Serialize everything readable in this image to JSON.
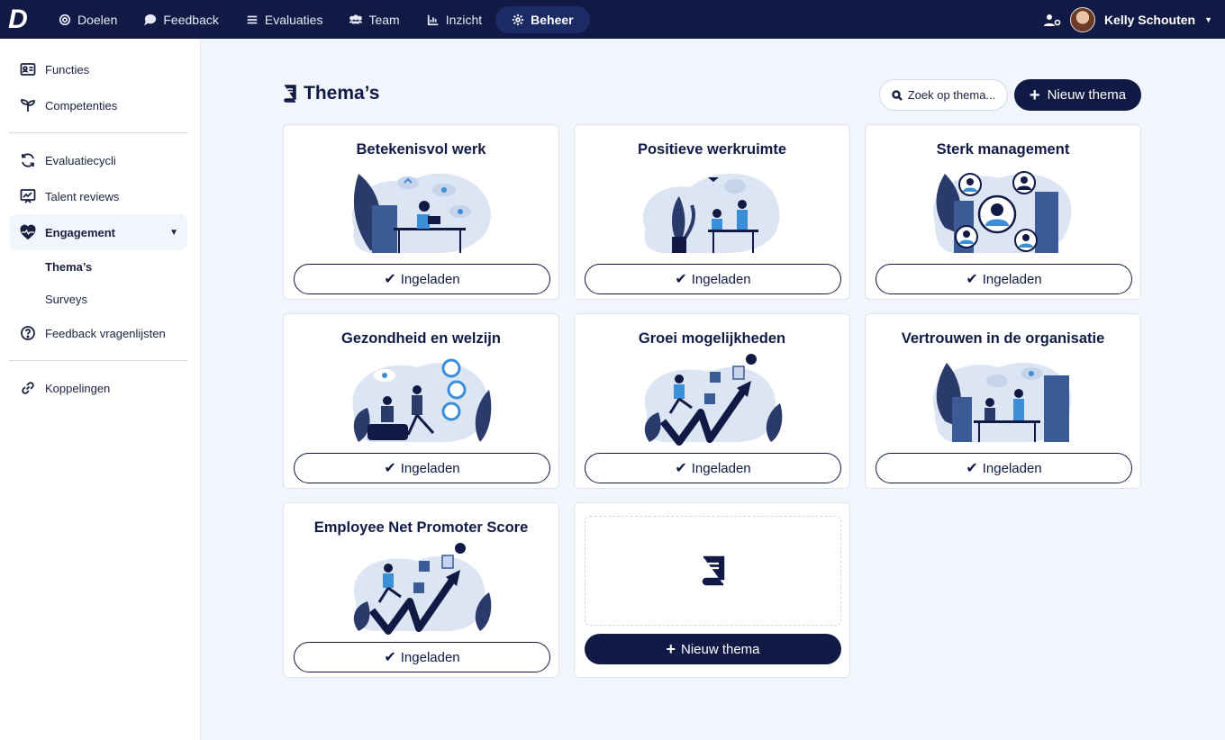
{
  "topbar": {
    "logo": "D",
    "nav": [
      {
        "label": "Doelen",
        "icon": "target-icon"
      },
      {
        "label": "Feedback",
        "icon": "chat-icon"
      },
      {
        "label": "Evaluaties",
        "icon": "list-icon"
      },
      {
        "label": "Team",
        "icon": "users-icon"
      },
      {
        "label": "Inzicht",
        "icon": "chart-icon"
      },
      {
        "label": "Beheer",
        "icon": "gear-icon",
        "active": true
      }
    ],
    "user_name": "Kelly Schouten"
  },
  "sidebar": {
    "items": [
      {
        "label": "Functies"
      },
      {
        "label": "Competenties"
      },
      {
        "label": "Evaluatiecycli"
      },
      {
        "label": "Talent reviews"
      },
      {
        "label": "Engagement"
      },
      {
        "label": "Thema’s"
      },
      {
        "label": "Surveys"
      },
      {
        "label": "Feedback vragenlijsten"
      },
      {
        "label": "Koppelingen"
      }
    ]
  },
  "main": {
    "title": "Thema’s",
    "search_label": "Zoek op thema...",
    "new_button": "Nieuw thema",
    "cards": [
      {
        "title": "Betekenisvol werk",
        "button": "Ingeladen"
      },
      {
        "title": "Positieve werkruimte",
        "button": "Ingeladen"
      },
      {
        "title": "Sterk management",
        "button": "Ingeladen"
      },
      {
        "title": "Gezondheid en welzijn",
        "button": "Ingeladen"
      },
      {
        "title": "Groei mogelijkheden",
        "button": "Ingeladen"
      },
      {
        "title": "Vertrouwen in de organisatie",
        "button": "Ingeladen"
      },
      {
        "title": "Employee Net Promoter Score",
        "button": "Ingeladen"
      }
    ],
    "new_card_button": "Nieuw thema"
  },
  "colors": {
    "navy": "#101a45",
    "accent_blue": "#3b8fd9",
    "blob": "#dbe5f3"
  }
}
